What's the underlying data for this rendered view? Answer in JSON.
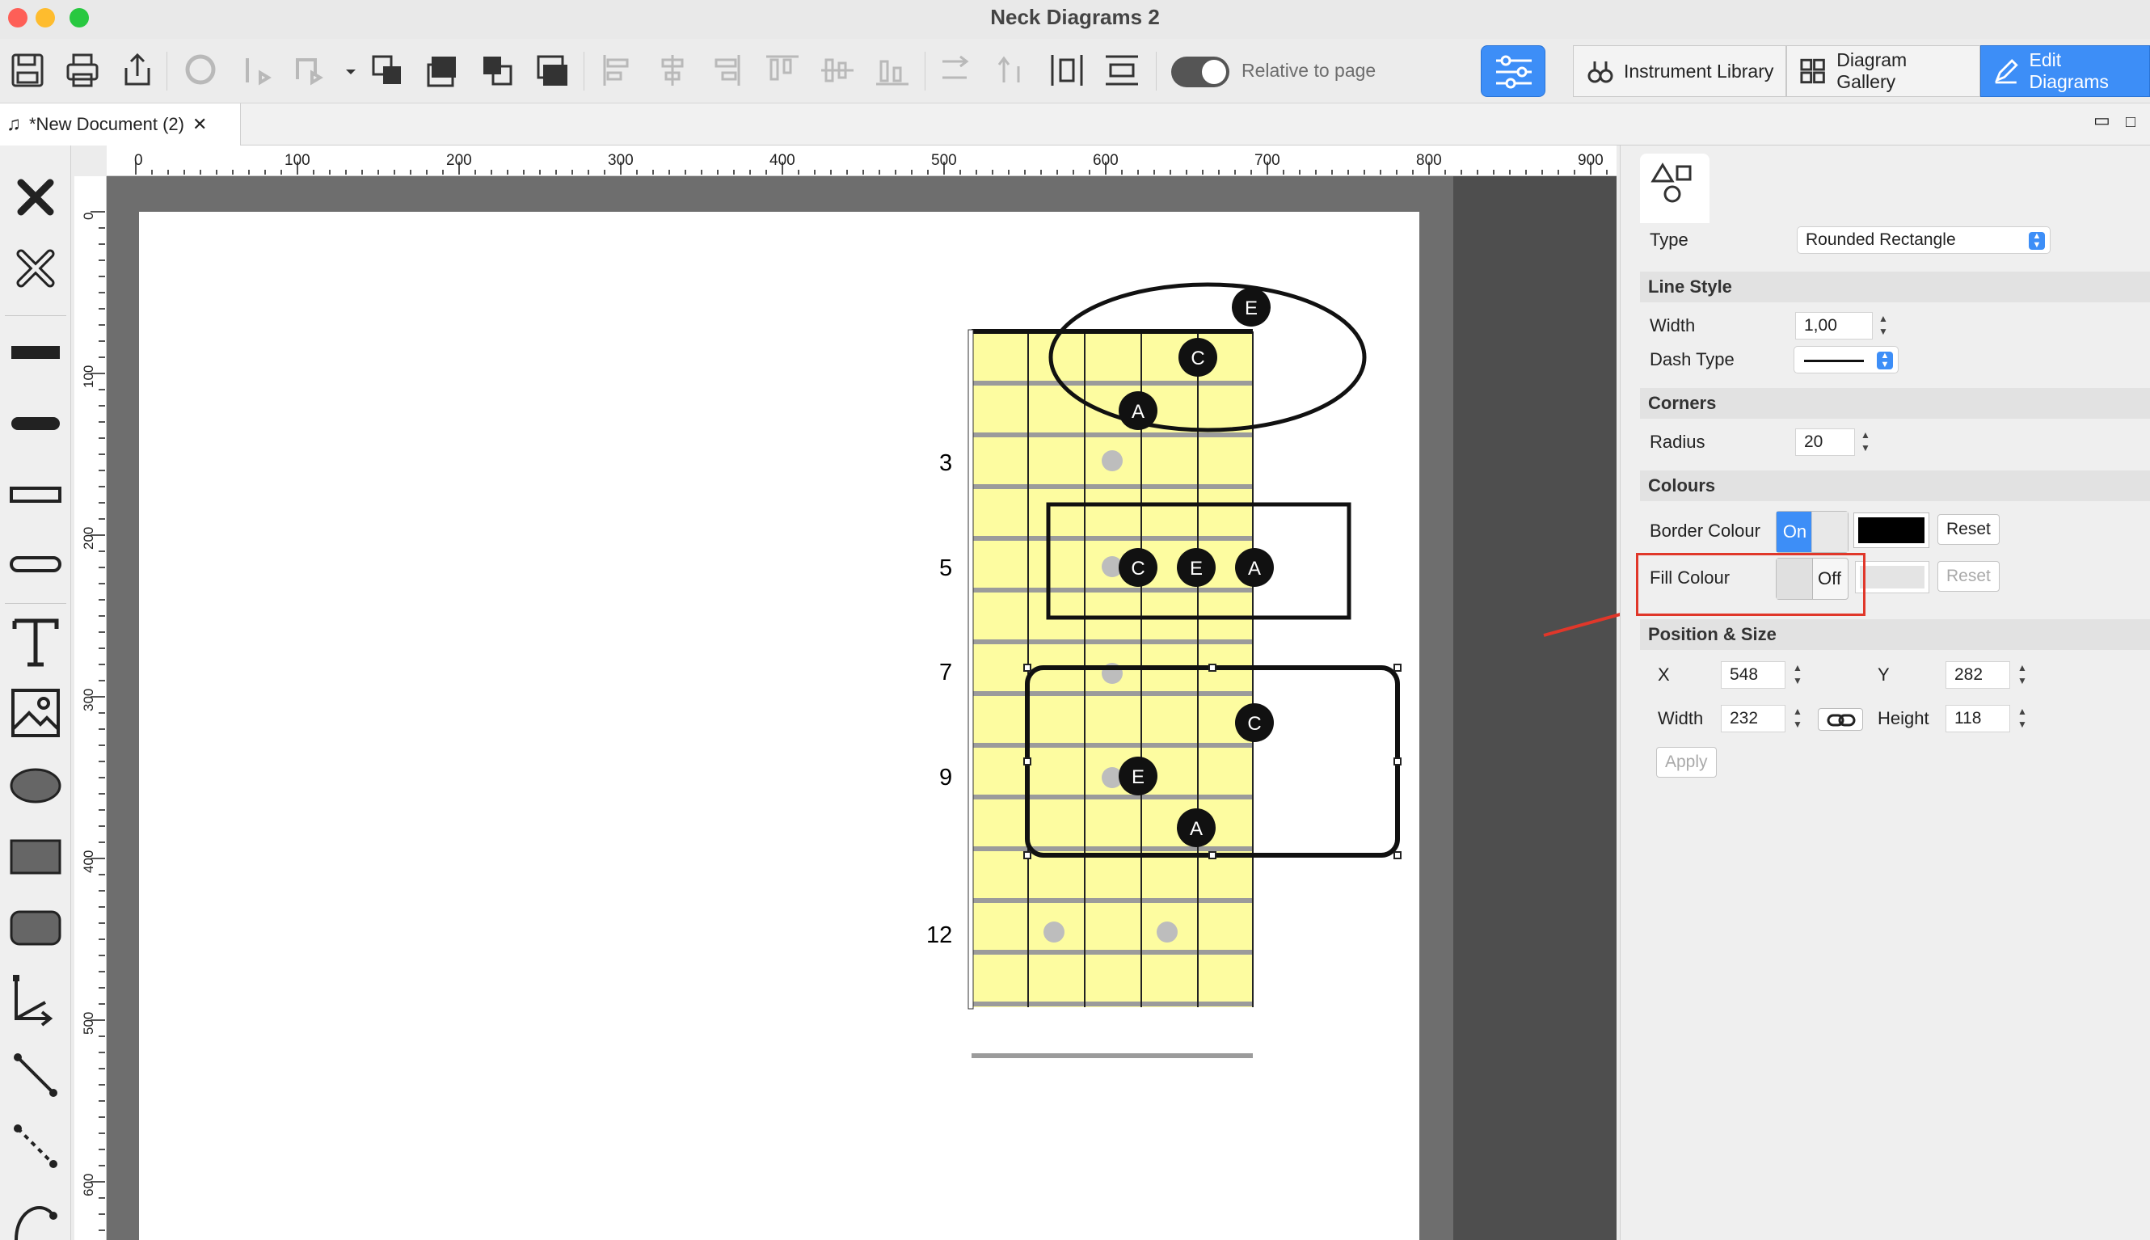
{
  "window": {
    "title": "Neck Diagrams 2"
  },
  "toolbar": {
    "relative_label": "Relative to page",
    "segments": [
      {
        "label": "Instrument Library",
        "icon": "guitar-icon"
      },
      {
        "label": "Diagram Gallery",
        "icon": "grid-icon"
      },
      {
        "label": "Edit Diagrams",
        "icon": "pencil-icon"
      }
    ]
  },
  "tab": {
    "title": "*New Document (2)"
  },
  "ruler": {
    "h": [
      "0",
      "100",
      "200",
      "300",
      "400",
      "500",
      "600",
      "700",
      "800",
      "900"
    ],
    "v": [
      "0",
      "100",
      "200",
      "300",
      "400",
      "500",
      "600"
    ]
  },
  "diagram": {
    "fret_labels": [
      "3",
      "5",
      "7",
      "9",
      "12"
    ],
    "notes": [
      "E",
      "C",
      "A",
      "C",
      "E",
      "A",
      "C",
      "E",
      "A"
    ]
  },
  "inspector": {
    "type_label": "Type",
    "type_value": "Rounded Rectangle",
    "line_style": {
      "header": "Line Style",
      "width_label": "Width",
      "width_value": "1,00",
      "dash_label": "Dash Type"
    },
    "corners": {
      "header": "Corners",
      "radius_label": "Radius",
      "radius_value": "20"
    },
    "colours": {
      "header": "Colours",
      "border_label": "Border Colour",
      "border_state": "On",
      "border_color": "#000000",
      "fill_label": "Fill Colour",
      "fill_state": "Off",
      "reset": "Reset"
    },
    "position": {
      "header": "Position & Size",
      "x_label": "X",
      "x_value": "548",
      "y_label": "Y",
      "y_value": "282",
      "w_label": "Width",
      "w_value": "232",
      "h_label": "Height",
      "h_value": "118",
      "apply": "Apply"
    }
  },
  "colors": {
    "accent": "#3d8ef7",
    "fretboard": "#fdfca0",
    "annotation": "#e0372a"
  }
}
